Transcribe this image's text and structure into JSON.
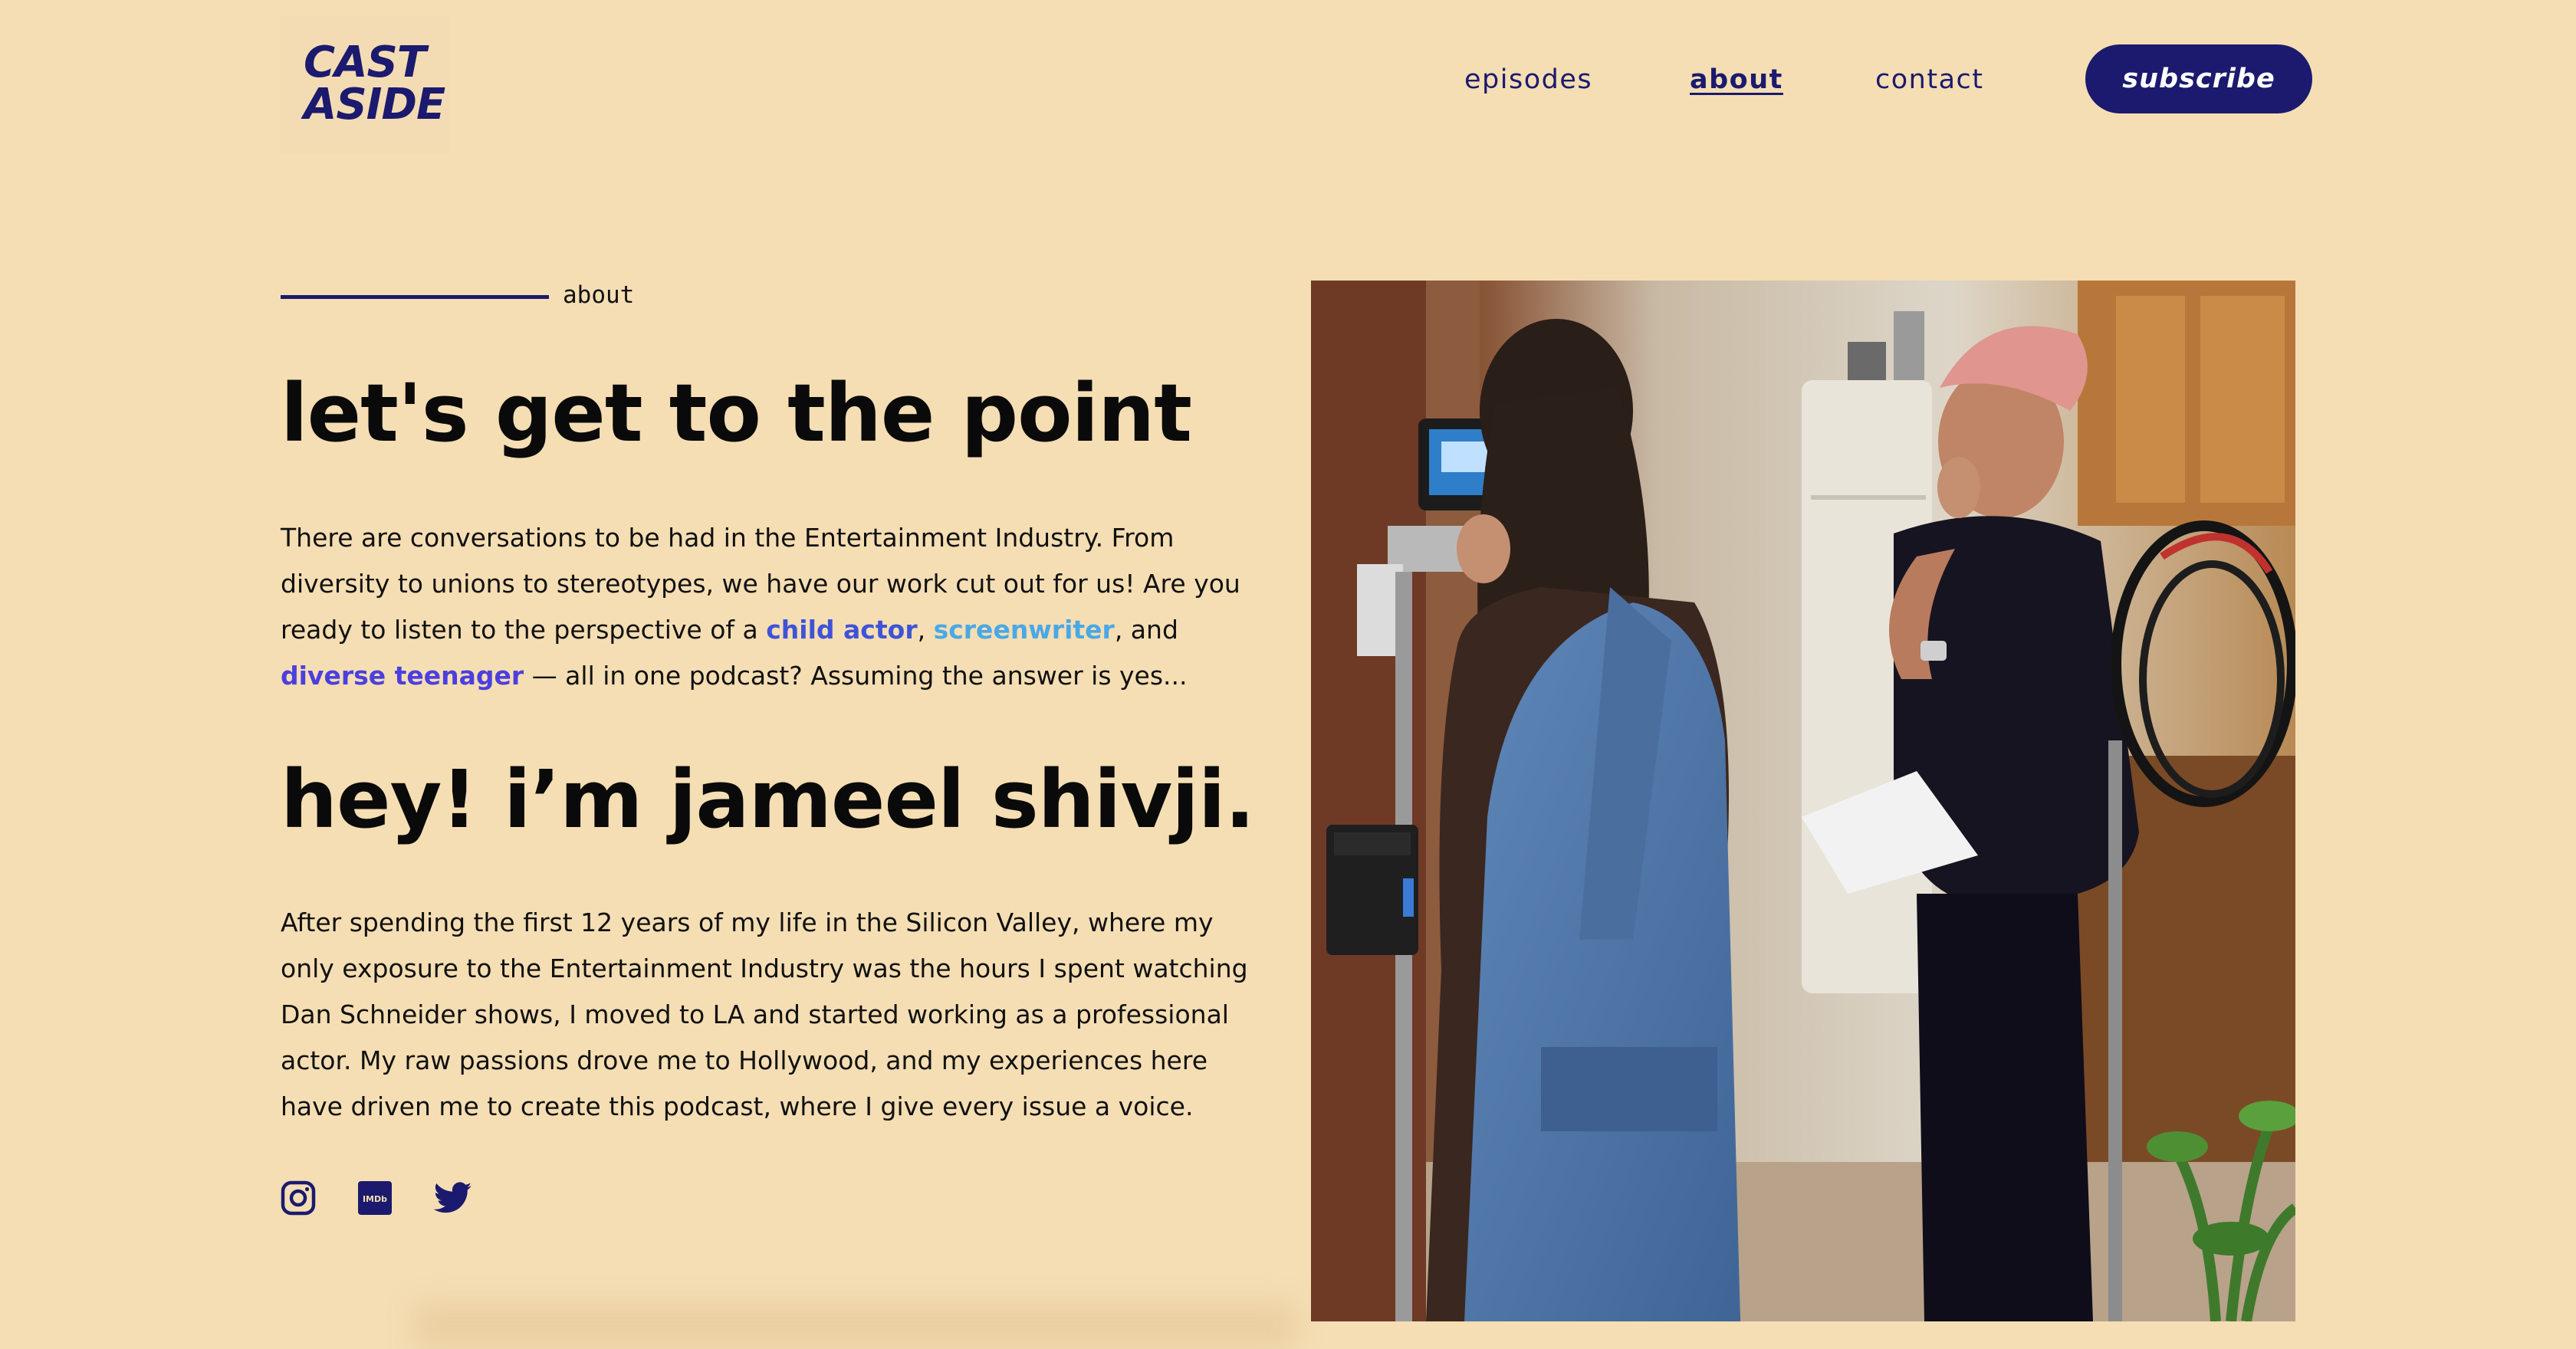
{
  "header": {
    "logo_line1": "CAST",
    "logo_line2": "ASIDE",
    "nav": {
      "episodes": "episodes",
      "about": "about",
      "contact": "contact"
    },
    "subscribe_label": "subscribe"
  },
  "about": {
    "section_label": "about",
    "heading": "let's get to the point",
    "intro": {
      "text_before": "There are conversations to be had in the Entertainment Industry. From diversity to unions to stereotypes, we have our work cut out for us! Are you ready to listen to the perspective of a ",
      "link_child_actor": "child actor",
      "sep1": ", ",
      "link_screenwriter": "screenwriter",
      "sep2": ", and ",
      "link_diverse_teenager": "diverse teenager",
      "text_after": " — all in one podcast? Assuming the answer is yes..."
    },
    "host_heading": "hey! i’m jameel shivji.",
    "bio": "After spending the first 12 years of my life in the Silicon Valley, where my only exposure to the Entertainment Industry was the hours I spent watching Dan Schneider shows, I moved to LA and started working as a professional actor. My raw passions drove me to Hollywood, and my experiences here have driven me to create this podcast, where I give every issue a voice.",
    "social_icons": [
      "instagram-icon",
      "imdb-icon",
      "twitter-icon"
    ],
    "imdb_text": "IMDb"
  },
  "colors": {
    "background": "#f5deb3",
    "brand_navy": "#1b1a6e",
    "link_child_actor": "#3f53d9",
    "link_screenwriter": "#4aa8e6",
    "link_diverse_teenager": "#4b3fe0"
  }
}
